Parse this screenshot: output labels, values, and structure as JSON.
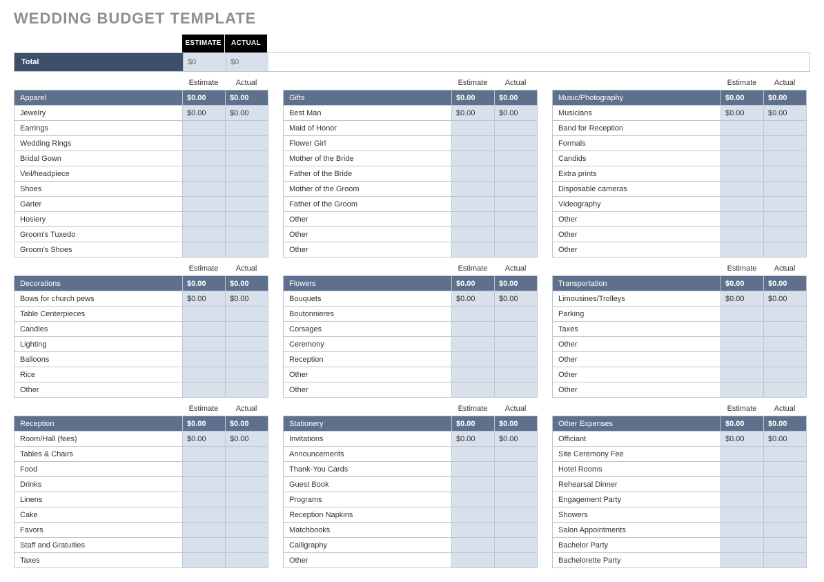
{
  "title": "WEDDING BUDGET TEMPLATE",
  "summary": {
    "headers": [
      "ESTIMATE",
      "ACTUAL"
    ],
    "total_label": "Total",
    "estimate": "$0",
    "actual": "$0"
  },
  "column_labels": {
    "estimate": "Estimate",
    "actual": "Actual"
  },
  "categories": [
    {
      "name": "Apparel",
      "estimate": "$0.00",
      "actual": "$0.00",
      "items": [
        {
          "name": "Jewelry",
          "estimate": "$0.00",
          "actual": "$0.00"
        },
        {
          "name": "Earrings",
          "estimate": "",
          "actual": ""
        },
        {
          "name": "Wedding Rings",
          "estimate": "",
          "actual": ""
        },
        {
          "name": "Bridal Gown",
          "estimate": "",
          "actual": ""
        },
        {
          "name": "Veil/headpiece",
          "estimate": "",
          "actual": ""
        },
        {
          "name": "Shoes",
          "estimate": "",
          "actual": ""
        },
        {
          "name": "Garter",
          "estimate": "",
          "actual": ""
        },
        {
          "name": "Hosiery",
          "estimate": "",
          "actual": ""
        },
        {
          "name": "Groom's Tuxedo",
          "estimate": "",
          "actual": ""
        },
        {
          "name": "Groom's Shoes",
          "estimate": "",
          "actual": ""
        }
      ]
    },
    {
      "name": "Gifts",
      "estimate": "$0.00",
      "actual": "$0.00",
      "items": [
        {
          "name": "Best Man",
          "estimate": "$0.00",
          "actual": "$0.00"
        },
        {
          "name": "Maid of Honor",
          "estimate": "",
          "actual": ""
        },
        {
          "name": "Flower Girl",
          "estimate": "",
          "actual": ""
        },
        {
          "name": "Mother of the Bride",
          "estimate": "",
          "actual": ""
        },
        {
          "name": "Father of the Bride",
          "estimate": "",
          "actual": ""
        },
        {
          "name": "Mother of the Groom",
          "estimate": "",
          "actual": ""
        },
        {
          "name": "Father of the Groom",
          "estimate": "",
          "actual": ""
        },
        {
          "name": "Other",
          "estimate": "",
          "actual": ""
        },
        {
          "name": "Other",
          "estimate": "",
          "actual": ""
        },
        {
          "name": "Other",
          "estimate": "",
          "actual": ""
        }
      ]
    },
    {
      "name": "Music/Photography",
      "estimate": "$0.00",
      "actual": "$0.00",
      "items": [
        {
          "name": "Musicians",
          "estimate": "$0.00",
          "actual": "$0.00"
        },
        {
          "name": "Band for Reception",
          "estimate": "",
          "actual": ""
        },
        {
          "name": "Formals",
          "estimate": "",
          "actual": ""
        },
        {
          "name": "Candids",
          "estimate": "",
          "actual": ""
        },
        {
          "name": "Extra prints",
          "estimate": "",
          "actual": ""
        },
        {
          "name": "Disposable cameras",
          "estimate": "",
          "actual": ""
        },
        {
          "name": "Videography",
          "estimate": "",
          "actual": ""
        },
        {
          "name": "Other",
          "estimate": "",
          "actual": ""
        },
        {
          "name": "Other",
          "estimate": "",
          "actual": ""
        },
        {
          "name": "Other",
          "estimate": "",
          "actual": ""
        }
      ]
    },
    {
      "name": "Decorations",
      "estimate": "$0.00",
      "actual": "$0.00",
      "items": [
        {
          "name": "Bows for church pews",
          "estimate": "$0.00",
          "actual": "$0.00"
        },
        {
          "name": "Table Centerpieces",
          "estimate": "",
          "actual": ""
        },
        {
          "name": "Candles",
          "estimate": "",
          "actual": ""
        },
        {
          "name": "Lighting",
          "estimate": "",
          "actual": ""
        },
        {
          "name": "Balloons",
          "estimate": "",
          "actual": ""
        },
        {
          "name": "Rice",
          "estimate": "",
          "actual": ""
        },
        {
          "name": "Other",
          "estimate": "",
          "actual": ""
        }
      ]
    },
    {
      "name": "Flowers",
      "estimate": "$0.00",
      "actual": "$0.00",
      "items": [
        {
          "name": "Bouquets",
          "estimate": "$0.00",
          "actual": "$0.00"
        },
        {
          "name": "Boutonnieres",
          "estimate": "",
          "actual": ""
        },
        {
          "name": "Corsages",
          "estimate": "",
          "actual": ""
        },
        {
          "name": "Ceremony",
          "estimate": "",
          "actual": ""
        },
        {
          "name": "Reception",
          "estimate": "",
          "actual": ""
        },
        {
          "name": "Other",
          "estimate": "",
          "actual": ""
        },
        {
          "name": "Other",
          "estimate": "",
          "actual": ""
        }
      ]
    },
    {
      "name": "Transportation",
      "estimate": "$0.00",
      "actual": "$0.00",
      "items": [
        {
          "name": "Limousines/Trolleys",
          "estimate": "$0.00",
          "actual": "$0.00"
        },
        {
          "name": "Parking",
          "estimate": "",
          "actual": ""
        },
        {
          "name": "Taxes",
          "estimate": "",
          "actual": ""
        },
        {
          "name": "Other",
          "estimate": "",
          "actual": ""
        },
        {
          "name": "Other",
          "estimate": "",
          "actual": ""
        },
        {
          "name": "Other",
          "estimate": "",
          "actual": ""
        },
        {
          "name": "Other",
          "estimate": "",
          "actual": ""
        }
      ]
    },
    {
      "name": "Reception",
      "estimate": "$0.00",
      "actual": "$0.00",
      "items": [
        {
          "name": "Room/Hall (fees)",
          "estimate": "$0.00",
          "actual": "$0.00"
        },
        {
          "name": "Tables & Chairs",
          "estimate": "",
          "actual": ""
        },
        {
          "name": "Food",
          "estimate": "",
          "actual": ""
        },
        {
          "name": "Drinks",
          "estimate": "",
          "actual": ""
        },
        {
          "name": "Linens",
          "estimate": "",
          "actual": ""
        },
        {
          "name": "Cake",
          "estimate": "",
          "actual": ""
        },
        {
          "name": "Favors",
          "estimate": "",
          "actual": ""
        },
        {
          "name": "Staff and Gratuities",
          "estimate": "",
          "actual": ""
        },
        {
          "name": "Taxes",
          "estimate": "",
          "actual": ""
        }
      ]
    },
    {
      "name": "Stationery",
      "estimate": "$0.00",
      "actual": "$0.00",
      "items": [
        {
          "name": "Invitations",
          "estimate": "$0.00",
          "actual": "$0.00"
        },
        {
          "name": "Announcements",
          "estimate": "",
          "actual": ""
        },
        {
          "name": "Thank-You Cards",
          "estimate": "",
          "actual": ""
        },
        {
          "name": "Guest Book",
          "estimate": "",
          "actual": ""
        },
        {
          "name": "Programs",
          "estimate": "",
          "actual": ""
        },
        {
          "name": "Reception Napkins",
          "estimate": "",
          "actual": ""
        },
        {
          "name": "Matchbooks",
          "estimate": "",
          "actual": ""
        },
        {
          "name": "Calligraphy",
          "estimate": "",
          "actual": ""
        },
        {
          "name": "Other",
          "estimate": "",
          "actual": ""
        }
      ]
    },
    {
      "name": "Other Expenses",
      "estimate": "$0.00",
      "actual": "$0.00",
      "items": [
        {
          "name": "Officiant",
          "estimate": "$0.00",
          "actual": "$0.00"
        },
        {
          "name": "Site Ceremony Fee",
          "estimate": "",
          "actual": ""
        },
        {
          "name": "Hotel Rooms",
          "estimate": "",
          "actual": ""
        },
        {
          "name": "Rehearsal Dinner",
          "estimate": "",
          "actual": ""
        },
        {
          "name": "Engagement Party",
          "estimate": "",
          "actual": ""
        },
        {
          "name": "Showers",
          "estimate": "",
          "actual": ""
        },
        {
          "name": "Salon Appointments",
          "estimate": "",
          "actual": ""
        },
        {
          "name": "Bachelor Party",
          "estimate": "",
          "actual": ""
        },
        {
          "name": "Bachelorette Party",
          "estimate": "",
          "actual": ""
        }
      ]
    }
  ]
}
